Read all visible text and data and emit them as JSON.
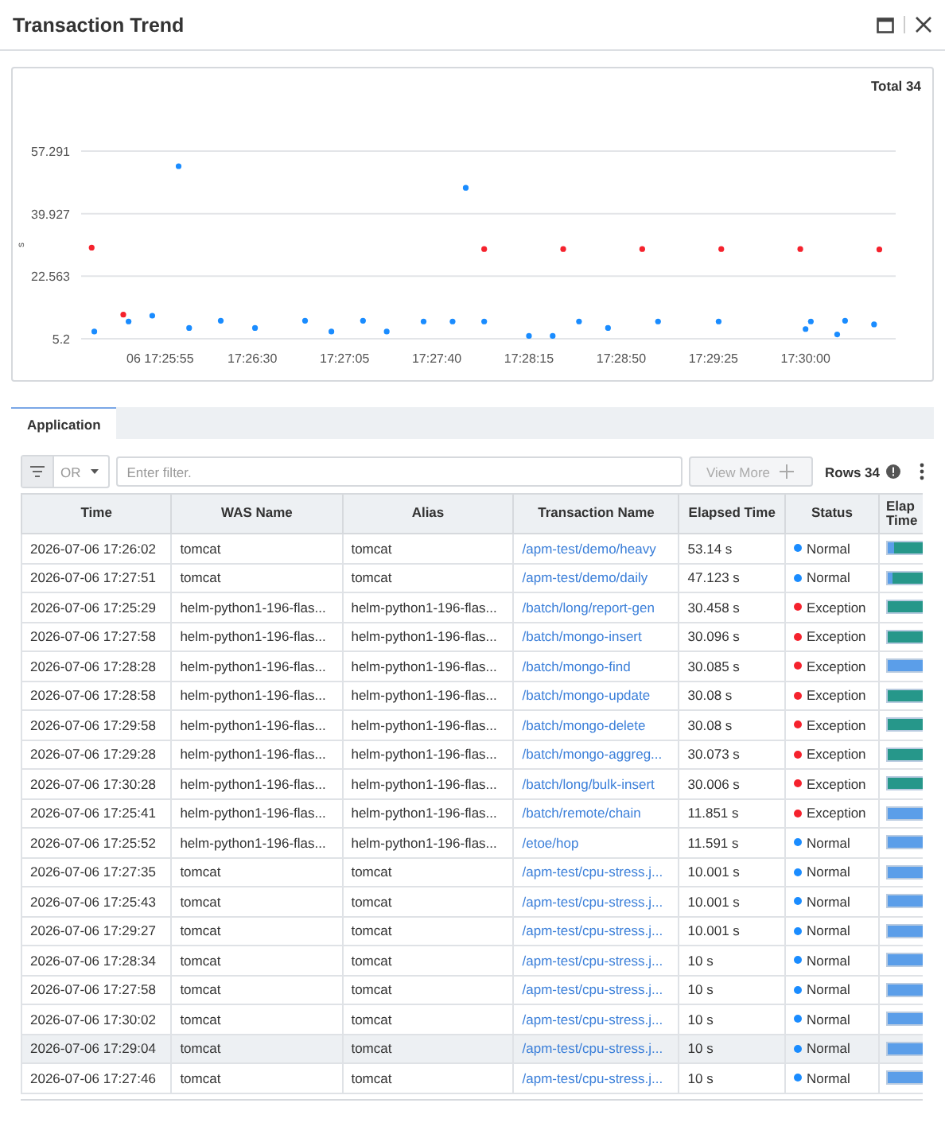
{
  "window": {
    "title": "Transaction Trend"
  },
  "chart": {
    "total": "Total 34",
    "chart_data": {
      "type": "scatter",
      "ylabel": "s",
      "grid": true,
      "xlim": [
        62725,
        63033
      ],
      "ylim": [
        5.2,
        57.291
      ],
      "yticks": [
        5.2,
        22.563,
        39.927,
        57.291
      ],
      "xticks": [
        {
          "value": 62755,
          "label": "06 17:25:55"
        },
        {
          "value": 62790,
          "label": "17:26:30"
        },
        {
          "value": 62825,
          "label": "17:27:05"
        },
        {
          "value": 62860,
          "label": "17:27:40"
        },
        {
          "value": 62895,
          "label": "17:28:15"
        },
        {
          "value": 62930,
          "label": "17:28:50"
        },
        {
          "value": 62965,
          "label": "17:29:25"
        },
        {
          "value": 63000,
          "label": "17:30:00"
        }
      ],
      "x": [
        62729,
        62730,
        62741,
        62743,
        62752,
        62762,
        62766,
        62778,
        62791,
        62810,
        62820,
        62832,
        62841,
        62855,
        62866,
        62871,
        62878,
        62895,
        62904,
        62908,
        62914,
        62925,
        62938,
        62944,
        62967,
        62968,
        62998,
        63000,
        63002,
        63012,
        63015,
        63026,
        63028
      ],
      "series": [
        {
          "color": "#1a8cff",
          "values": [
            null,
            7.2,
            null,
            10,
            11.6,
            53.1,
            8.2,
            10.2,
            8.2,
            10.2,
            7.2,
            10.2,
            7.2,
            10,
            10,
            47.1,
            10,
            6,
            6,
            null,
            10,
            8.2,
            null,
            10,
            10,
            null,
            null,
            7.9,
            10,
            6.4,
            10.2,
            9.2,
            null
          ]
        },
        {
          "color": "#f5222d",
          "values": [
            30.5,
            null,
            11.9,
            null,
            null,
            null,
            null,
            null,
            null,
            null,
            null,
            null,
            null,
            null,
            null,
            null,
            30.1,
            null,
            null,
            30.1,
            null,
            null,
            30.1,
            null,
            null,
            30.1,
            30.1,
            null,
            null,
            null,
            null,
            null,
            30
          ]
        }
      ]
    }
  },
  "tabs": [
    {
      "label": "Application",
      "selected": true
    }
  ],
  "toolbar": {
    "operator": "OR",
    "filter": {
      "placeholder": "Enter filter."
    },
    "view_more": {
      "label": "View More",
      "disabled": true
    },
    "rows": "Rows 34"
  },
  "table": {
    "columns": [
      "Time",
      "WAS Name",
      "Alias",
      "Transaction Name",
      "Elapsed Time",
      "Status",
      "Elap Time"
    ],
    "rows": [
      {
        "time": "2026-07-06 17:26:02",
        "was_name": "tomcat",
        "alias": "tomcat",
        "transaction": "/apm-test/demo/heavy",
        "elapsed": "53.14 s",
        "status": "Normal",
        "color": "#1a8cff",
        "selected": false,
        "bar": [
          {
            "color": "#5b9ee9",
            "level": 0.15
          },
          {
            "color": "#26978a",
            "level": 0.85
          }
        ]
      },
      {
        "time": "2026-07-06 17:27:51",
        "was_name": "tomcat",
        "alias": "tomcat",
        "transaction": "/apm-test/demo/daily",
        "elapsed": "47.123 s",
        "status": "Normal",
        "color": "#1a8cff",
        "selected": false,
        "bar": [
          {
            "color": "#5b9ee9",
            "level": 0.12
          },
          {
            "color": "#26978a",
            "level": 0.88
          }
        ]
      },
      {
        "time": "2026-07-06 17:25:29",
        "was_name": "helm-python1-196-flas...",
        "alias": "helm-python1-196-flas...",
        "transaction": "/batch/long/report-gen",
        "elapsed": "30.458 s",
        "status": "Exception",
        "color": "#f5222d",
        "selected": false,
        "bar": [
          {
            "color": "#26978a",
            "level": 1
          }
        ]
      },
      {
        "time": "2026-07-06 17:27:58",
        "was_name": "helm-python1-196-flas...",
        "alias": "helm-python1-196-flas...",
        "transaction": "/batch/mongo-insert",
        "elapsed": "30.096 s",
        "status": "Exception",
        "color": "#f5222d",
        "selected": false,
        "bar": [
          {
            "color": "#26978a",
            "level": 1
          }
        ]
      },
      {
        "time": "2026-07-06 17:28:28",
        "was_name": "helm-python1-196-flas...",
        "alias": "helm-python1-196-flas...",
        "transaction": "/batch/mongo-find",
        "elapsed": "30.085 s",
        "status": "Exception",
        "color": "#f5222d",
        "selected": false,
        "bar": [
          {
            "color": "#5b9ee9",
            "level": 1
          }
        ]
      },
      {
        "time": "2026-07-06 17:28:58",
        "was_name": "helm-python1-196-flas...",
        "alias": "helm-python1-196-flas...",
        "transaction": "/batch/mongo-update",
        "elapsed": "30.08 s",
        "status": "Exception",
        "color": "#f5222d",
        "selected": false,
        "bar": [
          {
            "color": "#26978a",
            "level": 1
          }
        ]
      },
      {
        "time": "2026-07-06 17:29:58",
        "was_name": "helm-python1-196-flas...",
        "alias": "helm-python1-196-flas...",
        "transaction": "/batch/mongo-delete",
        "elapsed": "30.08 s",
        "status": "Exception",
        "color": "#f5222d",
        "selected": false,
        "bar": [
          {
            "color": "#26978a",
            "level": 1
          }
        ]
      },
      {
        "time": "2026-07-06 17:29:28",
        "was_name": "helm-python1-196-flas...",
        "alias": "helm-python1-196-flas...",
        "transaction": "/batch/mongo-aggreg...",
        "elapsed": "30.073 s",
        "status": "Exception",
        "color": "#f5222d",
        "selected": false,
        "bar": [
          {
            "color": "#26978a",
            "level": 1
          }
        ]
      },
      {
        "time": "2026-07-06 17:30:28",
        "was_name": "helm-python1-196-flas...",
        "alias": "helm-python1-196-flas...",
        "transaction": "/batch/long/bulk-insert",
        "elapsed": "30.006 s",
        "status": "Exception",
        "color": "#f5222d",
        "selected": false,
        "bar": [
          {
            "color": "#26978a",
            "level": 1
          }
        ]
      },
      {
        "time": "2026-07-06 17:25:41",
        "was_name": "helm-python1-196-flas...",
        "alias": "helm-python1-196-flas...",
        "transaction": "/batch/remote/chain",
        "elapsed": "11.851 s",
        "status": "Exception",
        "color": "#f5222d",
        "selected": false,
        "bar": [
          {
            "color": "#5b9ee9",
            "level": 1
          }
        ]
      },
      {
        "time": "2026-07-06 17:25:52",
        "was_name": "helm-python1-196-flas...",
        "alias": "helm-python1-196-flas...",
        "transaction": "/etoe/hop",
        "elapsed": "11.591 s",
        "status": "Normal",
        "color": "#1a8cff",
        "selected": false,
        "bar": [
          {
            "color": "#5b9ee9",
            "level": 1
          }
        ]
      },
      {
        "time": "2026-07-06 17:27:35",
        "was_name": "tomcat",
        "alias": "tomcat",
        "transaction": "/apm-test/cpu-stress.j...",
        "elapsed": "10.001 s",
        "status": "Normal",
        "color": "#1a8cff",
        "selected": false,
        "bar": [
          {
            "color": "#5b9ee9",
            "level": 1
          }
        ]
      },
      {
        "time": "2026-07-06 17:25:43",
        "was_name": "tomcat",
        "alias": "tomcat",
        "transaction": "/apm-test/cpu-stress.j...",
        "elapsed": "10.001 s",
        "status": "Normal",
        "color": "#1a8cff",
        "selected": false,
        "bar": [
          {
            "color": "#5b9ee9",
            "level": 1
          }
        ]
      },
      {
        "time": "2026-07-06 17:29:27",
        "was_name": "tomcat",
        "alias": "tomcat",
        "transaction": "/apm-test/cpu-stress.j...",
        "elapsed": "10.001 s",
        "status": "Normal",
        "color": "#1a8cff",
        "selected": false,
        "bar": [
          {
            "color": "#5b9ee9",
            "level": 1
          }
        ]
      },
      {
        "time": "2026-07-06 17:28:34",
        "was_name": "tomcat",
        "alias": "tomcat",
        "transaction": "/apm-test/cpu-stress.j...",
        "elapsed": "10 s",
        "status": "Normal",
        "color": "#1a8cff",
        "selected": false,
        "bar": [
          {
            "color": "#5b9ee9",
            "level": 1
          }
        ]
      },
      {
        "time": "2026-07-06 17:27:58",
        "was_name": "tomcat",
        "alias": "tomcat",
        "transaction": "/apm-test/cpu-stress.j...",
        "elapsed": "10 s",
        "status": "Normal",
        "color": "#1a8cff",
        "selected": false,
        "bar": [
          {
            "color": "#5b9ee9",
            "level": 1
          }
        ]
      },
      {
        "time": "2026-07-06 17:30:02",
        "was_name": "tomcat",
        "alias": "tomcat",
        "transaction": "/apm-test/cpu-stress.j...",
        "elapsed": "10 s",
        "status": "Normal",
        "color": "#1a8cff",
        "selected": false,
        "bar": [
          {
            "color": "#5b9ee9",
            "level": 1
          }
        ]
      },
      {
        "time": "2026-07-06 17:29:04",
        "was_name": "tomcat",
        "alias": "tomcat",
        "transaction": "/apm-test/cpu-stress.j...",
        "elapsed": "10 s",
        "status": "Normal",
        "color": "#1a8cff",
        "selected": true,
        "bar": [
          {
            "color": "#5b9ee9",
            "level": 1
          }
        ]
      },
      {
        "time": "2026-07-06 17:27:46",
        "was_name": "tomcat",
        "alias": "tomcat",
        "transaction": "/apm-test/cpu-stress.j...",
        "elapsed": "10 s",
        "status": "Normal",
        "color": "#1a8cff",
        "selected": false,
        "bar": [
          {
            "color": "#5b9ee9",
            "level": 1
          }
        ]
      }
    ]
  }
}
